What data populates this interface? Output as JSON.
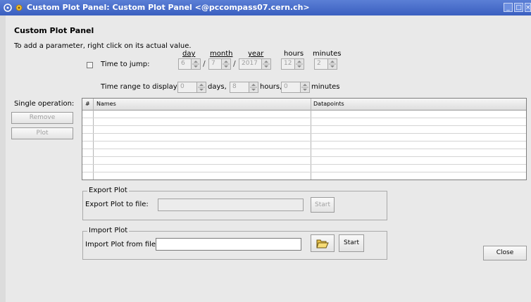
{
  "window": {
    "title": "Custom Plot Panel: Custom Plot Panel <@pccompass07.cern.ch>",
    "minimize_label": "_",
    "maximize_label": "□",
    "close_label": "×"
  },
  "panel": {
    "title": "Custom Plot Panel",
    "instructions": "To add a parameter, right click on its actual value."
  },
  "jump": {
    "checkbox_label": "Time to jump:",
    "checked": false,
    "headers": {
      "day": "day",
      "month": "month",
      "year": "year",
      "hours": "hours",
      "minutes": "minutes"
    },
    "day": "6",
    "month": "7",
    "year": "2017",
    "hours": "12",
    "minutes": "2",
    "sep1": "/",
    "sep2": "/"
  },
  "range": {
    "label": "Time range to display:",
    "days_value": "0",
    "days_unit": "days,",
    "hours_value": "8",
    "hours_unit": "hours,",
    "minutes_value": "0",
    "minutes_unit": "minutes"
  },
  "single_operation": {
    "label": "Single operation:",
    "remove_button": "Remove",
    "plot_button": "Plot"
  },
  "table": {
    "columns": [
      "#",
      "Names",
      "Datapoints"
    ],
    "rows": []
  },
  "export": {
    "group_title": "Export Plot",
    "label": "Export Plot to file:",
    "file_value": "",
    "start_button": "Start"
  },
  "import": {
    "group_title": "Import Plot",
    "label": "Import Plot from file:",
    "file_value": "",
    "browse_icon": "folder-open-icon",
    "start_button": "Start"
  },
  "close_button": "Close",
  "colors": {
    "titlebar": "#3a5fc0",
    "background": "#e9e9e9",
    "disabled_text": "#a0a0a0"
  }
}
